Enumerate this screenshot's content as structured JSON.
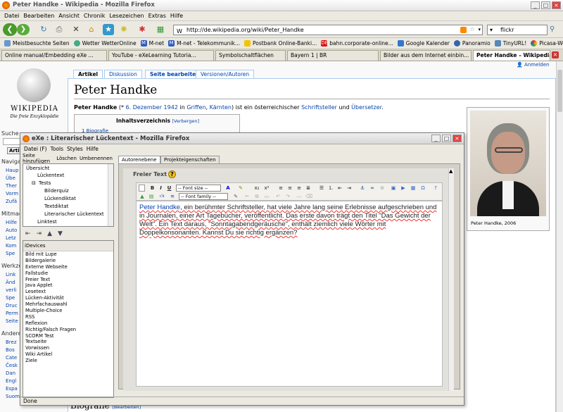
{
  "browser": {
    "title": "Peter Handke - Wikipedia - Mozilla Firefox",
    "menu": [
      "Datei",
      "Bearbeiten",
      "Ansicht",
      "Chronik",
      "Lesezeichen",
      "Extras",
      "Hilfe"
    ],
    "url": "http://de.wikipedia.org/wiki/Peter_Handke",
    "search_value": "flickr",
    "bookmarks": [
      "Meistbesuchte Seiten",
      "Wetter WetterOnline",
      "M-net",
      "M-net - Telekommunik...",
      "Postbank Online-Banki...",
      "bahn.corporate-online...",
      "Google Kalender",
      "Panoramio",
      "TinyURL!",
      "Picasa-Webalben"
    ],
    "tabs": [
      "Online manual/Embedding eXe ...",
      "YouTube - eXeLearning Tutoria...",
      "Symbolschaltflächen",
      "Bayern 1 | BR",
      "Bilder aus dem Internet einbin...",
      "Peter Handke – Wikipedia"
    ]
  },
  "wiki": {
    "logo_name": "WIKIPEDIA",
    "logo_sub": "Die freie Enzyklopädie",
    "tabs": [
      "Artikel",
      "Diskussion",
      "Seite bearbeiten",
      "Versionen/Autoren"
    ],
    "login": "Anmelden",
    "title": "Peter Handke",
    "lead_name": "Peter Handke",
    "lead_1": " (* ",
    "lead_date": "6. Dezember 1942",
    "lead_2": " in ",
    "lead_place": "Griffen",
    "lead_3": ", ",
    "lead_region": "Kärnten",
    "lead_4": ") ist ein österreichischer ",
    "lead_job1": "Schriftsteller",
    "lead_5": " und ",
    "lead_job2": "Übersetzer",
    "lead_6": ".",
    "toc_title": "Inhaltsverzeichnis",
    "toc_hide": "[Verbergen]",
    "toc_first": "1 Biografie",
    "caption": "Peter Handke, 2006",
    "section": "Biografie",
    "section_edit": "[Bearbeiten]",
    "side_search": "Suche",
    "side_search_btn": "Arti",
    "side_nav": "Navigat",
    "side_nav_items": [
      "Haup",
      "Übe",
      "Ther",
      "Vorm",
      "Zufä"
    ],
    "side_mit": "Mitmac",
    "side_mit_items": [
      "Hilfe",
      "Auto",
      "Letz",
      "Kom",
      "Spe"
    ],
    "side_werk": "Werkze",
    "side_werk_items": [
      "Link",
      "Änd",
      "verli",
      "Spe",
      "Druc",
      "Perm",
      "Seite"
    ],
    "side_andere": "Andere",
    "side_andere_items": [
      "Brez",
      "Bos",
      "Cate",
      "Česk",
      "Dan",
      "Engl",
      "Espa",
      "Suomi"
    ]
  },
  "exe": {
    "title": "eXe : Literarischer Lückentext - Mozilla Firefox",
    "menu": [
      "Datei (F)",
      "Tools",
      "Styles",
      "Hilfe"
    ],
    "outline_buttons": [
      "Seite hinzufügen",
      "Löschen",
      "Umbenennen"
    ],
    "outline": [
      "Übersicht",
      "Lückentext",
      "Tests",
      "Bilderquiz",
      "Lückendiktat",
      "Textdiktat",
      "Literarischer Lückentext",
      "Linktest"
    ],
    "idevices_header": "iDevices",
    "idevices": [
      "Bild mit Lupe",
      "Bildergalerie",
      "Externe Webseite",
      "Fallstudie",
      "Freier Text",
      "Java Applet",
      "Lesetext",
      "Lücken-Aktivität",
      "Mehrfachauswahl",
      "Multiple-Choice",
      "RSS",
      "Reflexion",
      "Richtig/Falsch Fragen",
      "SCORM Test",
      "Textseite",
      "Vorwissen",
      "Wiki Artikel",
      "Ziele"
    ],
    "tabs": [
      "Autorenebene",
      "Projekteigenschaften"
    ],
    "idevice_title": "Freier Text",
    "font_size": "-- Font size --",
    "font_family": "-- Font family --",
    "text_link": "Peter Handke",
    "text_body": ", ein berühmter Schriftsteller, hat viele Jahre lang seine Erlebnisse aufgeschrieben und in Journalen, einer Art Tagebücher, veröffentlicht. Das erste davon trägt den Titel \"Das Gewicht der Welt\". Ein Text daraus, \"Sonntagabendgeräusche\", enthält ziemlich viele Wörter mit Doppelkonsonanten. Kannst Du sie richtig ergänzen?",
    "status": "Done"
  },
  "colors": {
    "link": "#0645ad",
    "accent": "#3366cc"
  }
}
